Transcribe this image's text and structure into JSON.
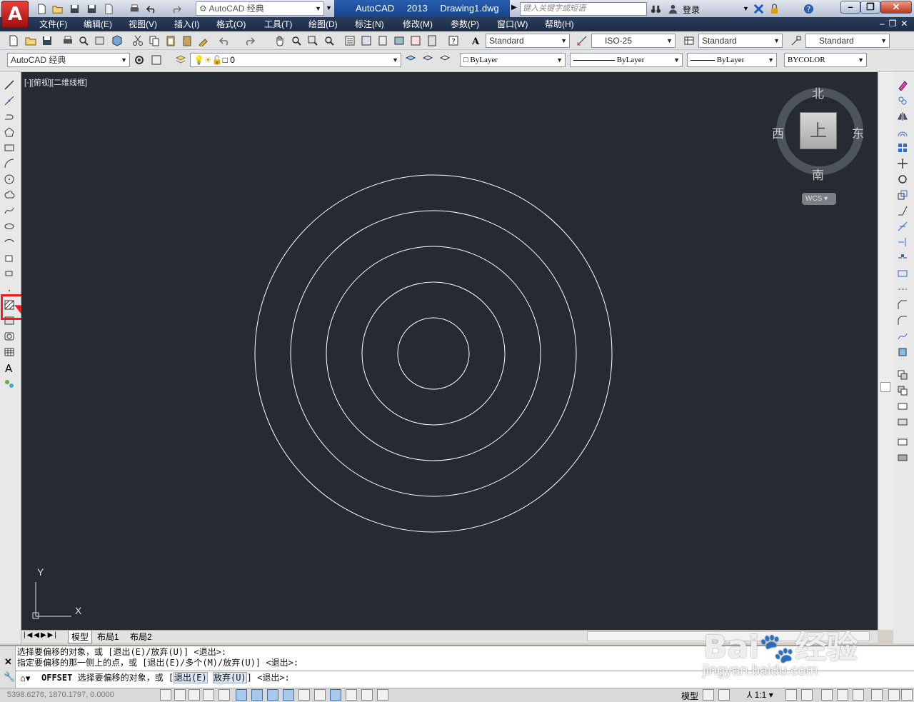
{
  "app": {
    "logo_letter": "A",
    "title": "AutoCAD 2013",
    "filename": "Drawing1.dwg"
  },
  "quick_access": {
    "workspace": "AutoCAD 经典"
  },
  "search": {
    "placeholder": "键入关键字或短语"
  },
  "user": {
    "login_label": "登录"
  },
  "menubar": {
    "items": [
      "文件(F)",
      "编辑(E)",
      "视图(V)",
      "插入(I)",
      "格式(O)",
      "工具(T)",
      "绘图(D)",
      "标注(N)",
      "修改(M)",
      "参数(P)",
      "窗口(W)",
      "帮助(H)"
    ]
  },
  "styles_toolbar": {
    "text_style": "Standard",
    "dim_style": "ISO-25",
    "table_style": "Standard",
    "mleader_style": "Standard"
  },
  "workspace_toolbar": {
    "workspace": "AutoCAD 经典"
  },
  "layers": {
    "current_layer": "0"
  },
  "properties": {
    "color": "ByLayer",
    "linetype": "ByLayer",
    "lineweight": "ByLayer",
    "plot_style": "BYCOLOR"
  },
  "viewport": {
    "label": "[-][俯视][二维线框]"
  },
  "viewcube": {
    "north": "北",
    "south": "南",
    "east": "东",
    "west": "西",
    "face": "上",
    "wcs": "WCS"
  },
  "ucs": {
    "x_label": "X",
    "y_label": "Y"
  },
  "drawing": {
    "circle_count": 5,
    "color": "#ffffff",
    "background": "#252a33"
  },
  "tabs": [
    {
      "label": "模型",
      "active": true
    },
    {
      "label": "布局1",
      "active": false
    },
    {
      "label": "布局2",
      "active": false
    }
  ],
  "command_history": [
    "选择要偏移的对象，或 [退出(E)/放弃(U)] <退出>:",
    "指定要偏移的那一侧上的点，或 [退出(E)/多个(M)/放弃(U)] <退出>:"
  ],
  "command_prompt": {
    "command": "OFFSET",
    "text": "选择要偏移的对象，或 [",
    "opt1": "退出(E)",
    "opt2": "放弃(U)",
    "tail": "] <退出>:"
  },
  "statusbar": {
    "coords": "5398.6276, 1870.1797, 0.0000",
    "model_label": "模型",
    "scale": "1:1"
  },
  "watermark": {
    "brand": "Bai",
    "brand_cn": "经验",
    "url": "jingyan.baidu.com"
  },
  "annotation": {
    "highlight_color": "#ff0000",
    "target": "hatch-tool"
  }
}
